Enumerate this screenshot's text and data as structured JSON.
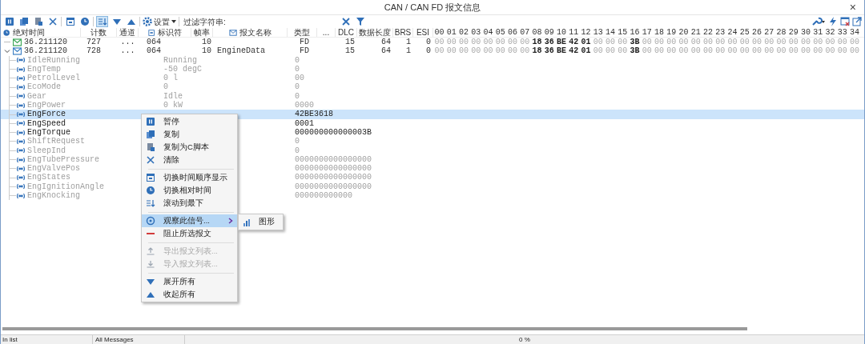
{
  "window": {
    "title": "CAN / CAN FD 报文信息",
    "close": "×"
  },
  "toolbar": {
    "buttons": [
      {
        "selected": false
      },
      {
        "selected": false
      },
      {
        "selected": false
      },
      {
        "selected": false
      },
      {
        "selected": false
      },
      {
        "selected": false
      },
      {
        "selected": true
      },
      {
        "selected": false
      },
      {
        "selected": false
      }
    ],
    "settings_label": "设置",
    "filter_label": "过滤字符串:"
  },
  "columns": [
    "绝对时间",
    "计数",
    "通道",
    "标识符",
    "帧率",
    "报文名称",
    "类型",
    "...",
    "DLC",
    "数据长度",
    "BRS",
    "ESI"
  ],
  "byte_columns": [
    "00",
    "01",
    "02",
    "03",
    "04",
    "05",
    "06",
    "07",
    "08",
    "09",
    "10",
    "11",
    "12",
    "13",
    "14",
    "15",
    "16",
    "17",
    "18",
    "19",
    "20",
    "21",
    "22",
    "23",
    "24",
    "25",
    "26",
    "27",
    "28",
    "29",
    "30",
    "31",
    "32",
    "33",
    "34"
  ],
  "messages": [
    {
      "color": "#3aa655",
      "time": "36.211120",
      "count": "727",
      "channel": "...",
      "id": "064",
      "rate": "10",
      "type": "FD",
      "dlc": "15",
      "length": "64",
      "brs": "1",
      "esi": "0",
      "bytes": [
        {
          "v": "00",
          "bold": false
        },
        {
          "v": "00",
          "bold": false
        },
        {
          "v": "00",
          "bold": false
        },
        {
          "v": "00",
          "bold": false
        },
        {
          "v": "00",
          "bold": false
        },
        {
          "v": "00",
          "bold": false
        },
        {
          "v": "00",
          "bold": false
        },
        {
          "v": "00",
          "bold": false
        },
        {
          "v": "18",
          "bold": true
        },
        {
          "v": "36",
          "bold": true
        },
        {
          "v": "BE",
          "bold": true
        },
        {
          "v": "42",
          "bold": true
        },
        {
          "v": "01",
          "bold": true
        },
        {
          "v": "00",
          "bold": false
        },
        {
          "v": "00",
          "bold": false
        },
        {
          "v": "00",
          "bold": false
        },
        {
          "v": "3B",
          "bold": true
        },
        {
          "v": "00",
          "bold": false
        },
        {
          "v": "00",
          "bold": false
        },
        {
          "v": "00",
          "bold": false
        },
        {
          "v": "00",
          "bold": false
        },
        {
          "v": "00",
          "bold": false
        },
        {
          "v": "00",
          "bold": false
        },
        {
          "v": "00",
          "bold": false
        },
        {
          "v": "00",
          "bold": false
        },
        {
          "v": "00",
          "bold": false
        },
        {
          "v": "00",
          "bold": false
        },
        {
          "v": "00",
          "bold": false
        },
        {
          "v": "00",
          "bold": false
        },
        {
          "v": "00",
          "bold": false
        },
        {
          "v": "00",
          "bold": false
        },
        {
          "v": "00",
          "bold": false
        },
        {
          "v": "00",
          "bold": false
        },
        {
          "v": "00",
          "bold": false
        },
        {
          "v": "00",
          "bold": false
        }
      ]
    },
    {
      "color": "#3b7fc4",
      "time": "36.211120",
      "count": "728",
      "channel": "...",
      "id": "064",
      "rate": "10",
      "name": "EngineData",
      "type": "FD",
      "dlc": "15",
      "length": "64",
      "brs": "1",
      "esi": "0",
      "bytes": [
        {
          "v": "00",
          "bold": false
        },
        {
          "v": "00",
          "bold": false
        },
        {
          "v": "00",
          "bold": false
        },
        {
          "v": "00",
          "bold": false
        },
        {
          "v": "00",
          "bold": false
        },
        {
          "v": "00",
          "bold": false
        },
        {
          "v": "00",
          "bold": false
        },
        {
          "v": "00",
          "bold": false
        },
        {
          "v": "18",
          "bold": true
        },
        {
          "v": "36",
          "bold": true
        },
        {
          "v": "BE",
          "bold": true
        },
        {
          "v": "42",
          "bold": true
        },
        {
          "v": "01",
          "bold": true
        },
        {
          "v": "00",
          "bold": false
        },
        {
          "v": "00",
          "bold": false
        },
        {
          "v": "00",
          "bold": false
        },
        {
          "v": "3B",
          "bold": true
        },
        {
          "v": "00",
          "bold": false
        },
        {
          "v": "00",
          "bold": false
        },
        {
          "v": "00",
          "bold": false
        },
        {
          "v": "00",
          "bold": false
        },
        {
          "v": "00",
          "bold": false
        },
        {
          "v": "00",
          "bold": false
        },
        {
          "v": "00",
          "bold": false
        },
        {
          "v": "00",
          "bold": false
        },
        {
          "v": "00",
          "bold": false
        },
        {
          "v": "00",
          "bold": false
        },
        {
          "v": "00",
          "bold": false
        },
        {
          "v": "00",
          "bold": false
        },
        {
          "v": "00",
          "bold": false
        },
        {
          "v": "00",
          "bold": false
        },
        {
          "v": "00",
          "bold": false
        },
        {
          "v": "00",
          "bold": false
        },
        {
          "v": "00",
          "bold": false
        },
        {
          "v": "00",
          "bold": false
        }
      ],
      "children": [
        {
          "name": "IdleRunning",
          "value": "Running",
          "raw": "0",
          "active": false,
          "selected": false
        },
        {
          "name": "EngTemp",
          "value": "-50 degC",
          "raw": "0",
          "active": false,
          "selected": false
        },
        {
          "name": "PetrolLevel",
          "value": "0 l",
          "raw": "00",
          "active": false,
          "selected": false
        },
        {
          "name": "EcoMode",
          "value": "0",
          "raw": "0",
          "active": false,
          "selected": false
        },
        {
          "name": "Gear",
          "value": "Idle",
          "raw": "0",
          "active": false,
          "selected": false
        },
        {
          "name": "EngPower",
          "value": "0 kW",
          "raw": "0000",
          "active": false,
          "selected": false
        },
        {
          "name": "EngForce",
          "raw": "42BE3618",
          "active": true,
          "selected": true
        },
        {
          "name": "EngSpeed",
          "raw": "0001",
          "active": true,
          "selected": false
        },
        {
          "name": "EngTorque",
          "raw": "000000000000003B",
          "active": true,
          "selected": false
        },
        {
          "name": "ShiftRequest",
          "raw": "0",
          "active": false,
          "selected": false
        },
        {
          "name": "SleepInd",
          "raw": "0",
          "active": false,
          "selected": false
        },
        {
          "name": "EngTubePressure",
          "raw": "0000000000000000",
          "active": false,
          "selected": false
        },
        {
          "name": "EngValvePos",
          "raw": "0000000000000000",
          "active": false,
          "selected": false
        },
        {
          "name": "EngStates",
          "raw": "0000000000000000",
          "active": false,
          "selected": false
        },
        {
          "name": "EngIgnitionAngle",
          "raw": "0000000000000000",
          "active": false,
          "selected": false
        },
        {
          "name": "EngKnocking",
          "raw": "000000000000",
          "active": false,
          "selected": false
        }
      ]
    }
  ],
  "context_menu": [
    {
      "kind": "item",
      "label": "暂停",
      "disabled": false,
      "selected": false
    },
    {
      "kind": "item",
      "label": "复制",
      "disabled": false,
      "selected": false
    },
    {
      "kind": "item",
      "label": "复制为C脚本",
      "disabled": false,
      "selected": false
    },
    {
      "kind": "item",
      "label": "清除",
      "disabled": false,
      "selected": false
    },
    {
      "kind": "separator"
    },
    {
      "kind": "item",
      "label": "切换时间顺序显示",
      "disabled": false,
      "selected": false
    },
    {
      "kind": "item",
      "label": "切换相对时间",
      "disabled": false,
      "selected": false
    },
    {
      "kind": "item",
      "label": "滚动到最下",
      "disabled": false,
      "selected": false
    },
    {
      "kind": "separator"
    },
    {
      "kind": "submenu",
      "label": "观察此信号...",
      "disabled": false,
      "selected": true,
      "submenu": [
        {
          "label": "图形"
        }
      ]
    },
    {
      "kind": "item",
      "label": "阻止所选报文",
      "disabled": false,
      "selected": false
    },
    {
      "kind": "separator"
    },
    {
      "kind": "item",
      "label": "导出报文列表...",
      "disabled": true,
      "selected": false
    },
    {
      "kind": "item",
      "label": "导入报文列表...",
      "disabled": true,
      "selected": false
    },
    {
      "kind": "separator"
    },
    {
      "kind": "item",
      "label": "展开所有",
      "disabled": false,
      "selected": false
    },
    {
      "kind": "item",
      "label": "收起所有",
      "disabled": false,
      "selected": false
    }
  ],
  "status_bar": [
    "In list",
    "All Messages",
    "0 %"
  ]
}
